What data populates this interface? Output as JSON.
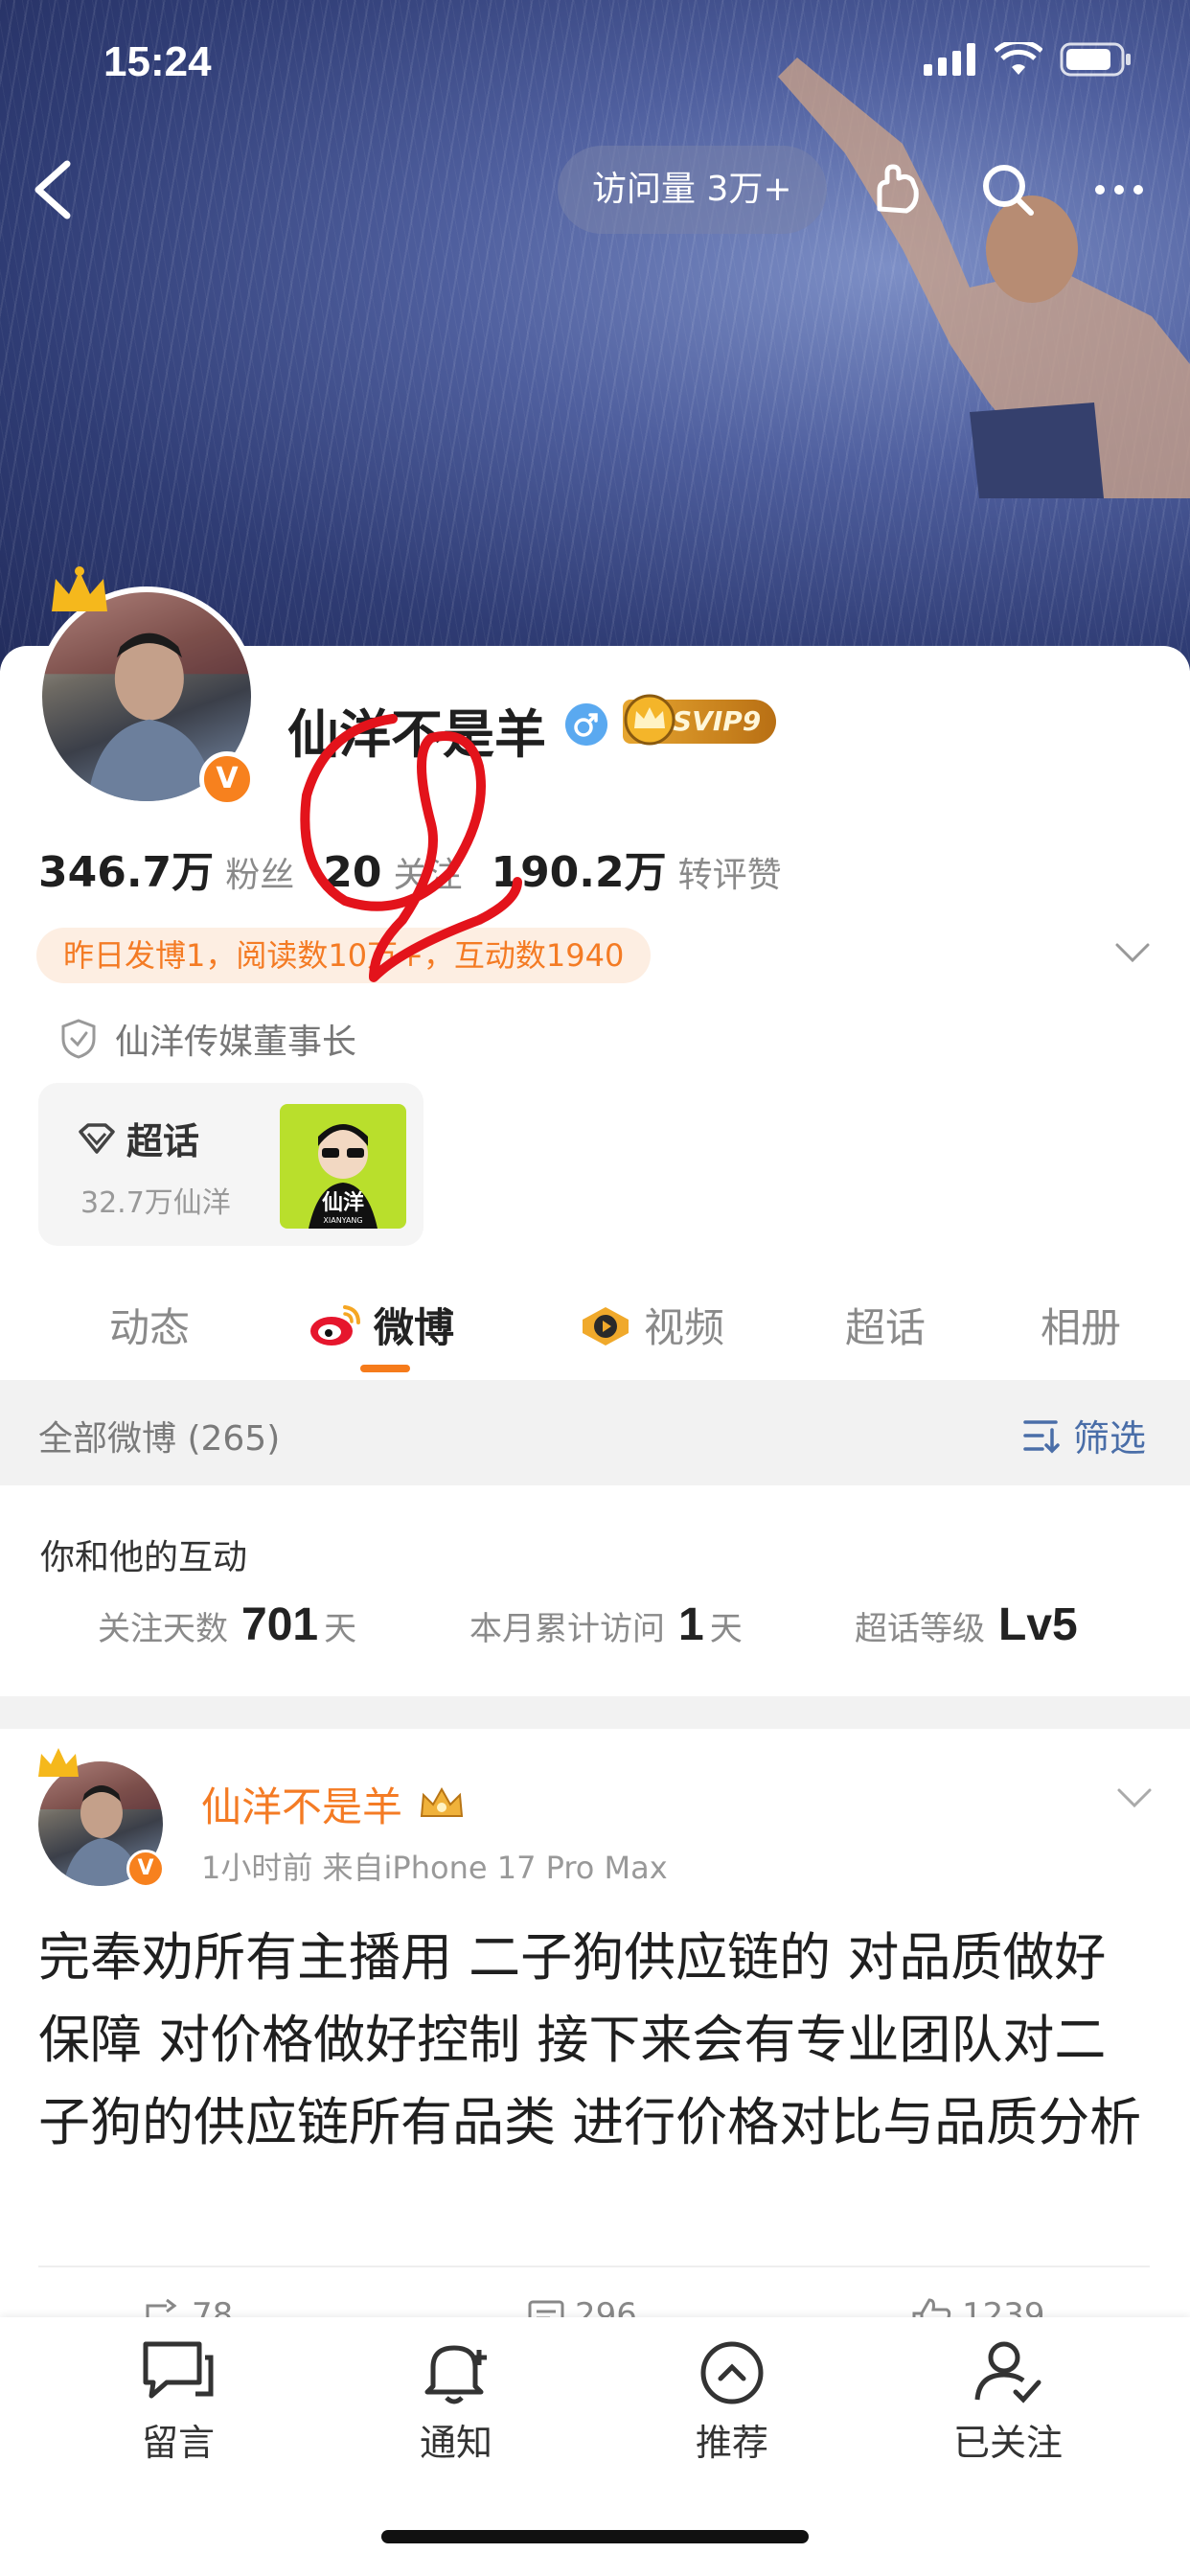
{
  "status_bar": {
    "time": "15:24"
  },
  "header": {
    "visit_label": "访问量 3万+"
  },
  "profile": {
    "name": "仙洋不是羊",
    "vip_badge": "SVIP9",
    "verified_badge": "V",
    "stats": [
      {
        "value": "346.7万",
        "label": "粉丝"
      },
      {
        "value": "20",
        "label": "关注"
      },
      {
        "value": "190.2万",
        "label": "转评赞"
      }
    ],
    "activity_hint": "昨日发博1，阅读数10万+，互动数1940",
    "organization": "仙洋传媒董事长"
  },
  "supertopic": {
    "title": "超话",
    "count": "32.7万仙洋",
    "image_text": "仙洋",
    "image_subtext": "XIANYANG"
  },
  "tabs": [
    {
      "label": "动态"
    },
    {
      "label": "微博",
      "active": true
    },
    {
      "label": "视频"
    },
    {
      "label": "超话"
    },
    {
      "label": "相册"
    }
  ],
  "filter_bar": {
    "title": "全部微博 (265)",
    "filter_label": "筛选"
  },
  "interaction": {
    "title": "你和他的互动",
    "stats": [
      {
        "label": "关注天数",
        "value": "701",
        "unit": "天"
      },
      {
        "label": "本月累计访问",
        "value": "1",
        "unit": "天"
      },
      {
        "label": "超话等级",
        "value": "Lv5",
        "unit": ""
      }
    ]
  },
  "post": {
    "author": "仙洋不是羊",
    "meta": "1小时前  来自iPhone 17 Pro Max",
    "body": "完奉劝所有主播用 二子狗供应链的 对品质做好保障 对价格做好控制 接下来会有专业团队对二子狗的供应链所有品类 进行价格对比与品质分析",
    "actions": {
      "repost": "78",
      "comment": "296",
      "like": "1239"
    }
  },
  "bottom_bar": [
    {
      "label": "留言",
      "icon": "message-icon"
    },
    {
      "label": "通知",
      "icon": "bell-plus-icon"
    },
    {
      "label": "推荐",
      "icon": "chevron-up-circle-icon"
    },
    {
      "label": "已关注",
      "icon": "user-check-icon"
    }
  ],
  "colors": {
    "accent": "#f67b1b",
    "link_blue": "#4a6ea8",
    "annotation_red": "#e3131b"
  }
}
